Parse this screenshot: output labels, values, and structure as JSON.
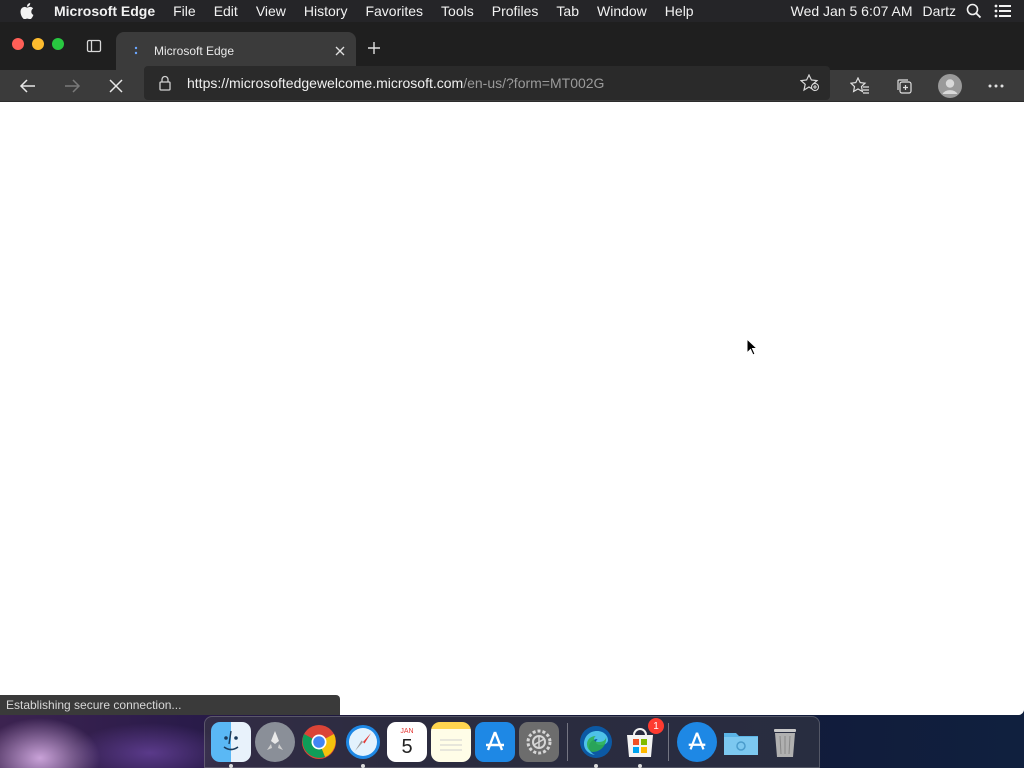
{
  "menubar": {
    "app_name": "Microsoft Edge",
    "menus": [
      "File",
      "Edit",
      "View",
      "History",
      "Favorites",
      "Tools",
      "Profiles",
      "Tab",
      "Window",
      "Help"
    ],
    "datetime": "Wed Jan 5  6:07 AM",
    "user": "Dartz"
  },
  "browser": {
    "tab_title": "Microsoft Edge",
    "url_host": "https://microsoftedgewelcome.microsoft.com",
    "url_path": "/en-us/?form=MT002G",
    "status_text": "Establishing secure connection..."
  },
  "dock": {
    "calendar_month": "JAN",
    "calendar_day": "5",
    "store_badge": "1"
  },
  "colors": {
    "close": "#ff5f57",
    "minimize": "#febc2e",
    "maximize": "#28c840",
    "chrome_dark": "#3b3b3b"
  }
}
